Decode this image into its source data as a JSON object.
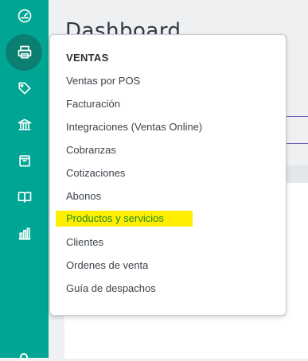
{
  "page": {
    "title": "Dashboard"
  },
  "sidebar": {
    "items": [
      {
        "icon": "speedometer-icon"
      },
      {
        "icon": "printer-icon",
        "active": true
      },
      {
        "icon": "tag-icon"
      },
      {
        "icon": "bank-icon"
      },
      {
        "icon": "box-icon"
      },
      {
        "icon": "book-icon"
      },
      {
        "icon": "bar-chart-icon"
      }
    ]
  },
  "menu": {
    "heading": "VENTAS",
    "items": [
      {
        "label": "Ventas por POS"
      },
      {
        "label": "Facturación"
      },
      {
        "label": "Integraciones (Ventas Online)"
      },
      {
        "label": "Cobranzas"
      },
      {
        "label": "Cotizaciones"
      },
      {
        "label": "Abonos"
      },
      {
        "label": "Productos y servicios",
        "highlighted": true
      },
      {
        "label": "Clientes"
      },
      {
        "label": "Ordenes de venta"
      },
      {
        "label": "Guía de despachos"
      }
    ]
  },
  "colors": {
    "sidebar": "#00a693",
    "active_bg": "#0b7f72",
    "highlight_bg": "#ffee00",
    "highlight_text": "#1f8a2c"
  }
}
